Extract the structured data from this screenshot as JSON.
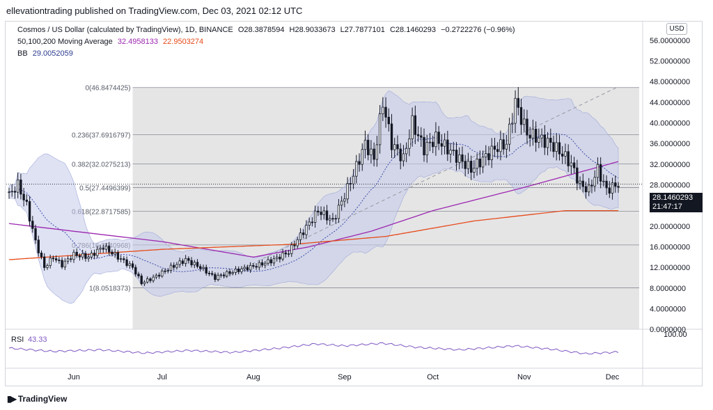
{
  "publisher_line": "ellevationtrading published on TradingView.com, Dec 03, 2021 02:12 UTC",
  "header": {
    "symbol": "Cosmos / US Dollar (calculated by TradingView), 1D, BINANCE",
    "open": "O28.3878594",
    "high": "H28.9033673",
    "low": "L27.7877101",
    "close": "C28.1460293",
    "change": "−0.2722276 (−0.96%)",
    "ma_label": "50,100,200 Moving Average",
    "ma_value_1": "32.4958133",
    "ma_value_2": "22.9503274",
    "bb_label": "BB",
    "bb_value": "29.0052059"
  },
  "currency_button": "USD",
  "last_price": "28.1460293",
  "countdown": "21:47:17",
  "rsi": {
    "label": "RSI",
    "value": "43.33",
    "level_label": "100.00"
  },
  "logo_text": "TradingView",
  "colors": {
    "up": "#ffffff",
    "down": "#131722",
    "ma_purple": "#9c27b0",
    "ma_red": "#e64a19",
    "bb_fill": "#c5cae9",
    "fib_fill": "#dcdcde",
    "rsi_line": "#7e57c2"
  },
  "chart_data": {
    "type": "candlestick",
    "x_axis": {
      "ticks": [
        "Jun",
        "Jul",
        "Aug",
        "Sep",
        "Oct",
        "Nov",
        "Dec"
      ],
      "range": [
        "2021-05-10",
        "2021-12-03"
      ]
    },
    "y_axis": {
      "ticks": [
        "0.0000000",
        "4.0000000",
        "8.0000000",
        "12.0000000",
        "16.0000000",
        "20.0000000",
        "24.0000000",
        "28.0000000",
        "32.0000000",
        "36.0000000",
        "40.0000000",
        "44.0000000",
        "48.0000000",
        "52.0000000",
        "56.0000000"
      ],
      "tick_values": [
        0,
        4,
        8,
        12,
        16,
        20,
        24,
        28,
        32,
        36,
        40,
        44,
        48,
        52,
        56
      ],
      "ylim": [
        -2,
        58
      ]
    },
    "fibonacci": {
      "start_date": "2021-06-21",
      "end_date": "2021-12-03",
      "levels": [
        {
          "label": "0(46.8474425)",
          "value": 46.8474425
        },
        {
          "label": "0.236(37.6916797)",
          "value": 37.6916797
        },
        {
          "label": "0.382(32.0275213)",
          "value": 32.0275213
        },
        {
          "label": "0.5(27.4496399)",
          "value": 27.4496399
        },
        {
          "label": "0.618(22.8717585)",
          "value": 22.8717585
        },
        {
          "label": "0.786(16.3540968)",
          "value": 16.3540968
        },
        {
          "label": "1(8.0518373)",
          "value": 8.0518373
        }
      ]
    },
    "trendline": {
      "from": [
        "2021-07-20",
        9.5
      ],
      "to": [
        "2021-12-03",
        47
      ]
    },
    "close_anchors": [
      [
        "2021-05-10",
        26
      ],
      [
        "2021-05-13",
        28
      ],
      [
        "2021-05-16",
        24
      ],
      [
        "2021-05-19",
        17
      ],
      [
        "2021-05-22",
        12
      ],
      [
        "2021-05-25",
        14
      ],
      [
        "2021-05-28",
        12.5
      ],
      [
        "2021-06-01",
        14.5
      ],
      [
        "2021-06-06",
        14
      ],
      [
        "2021-06-11",
        16
      ],
      [
        "2021-06-16",
        14
      ],
      [
        "2021-06-21",
        12
      ],
      [
        "2021-06-24",
        9
      ],
      [
        "2021-06-28",
        10
      ],
      [
        "2021-07-04",
        12
      ],
      [
        "2021-07-09",
        13.5
      ],
      [
        "2021-07-14",
        12
      ],
      [
        "2021-07-19",
        10
      ],
      [
        "2021-07-21",
        10.5
      ],
      [
        "2021-07-27",
        11.5
      ],
      [
        "2021-08-03",
        12.5
      ],
      [
        "2021-08-08",
        13.5
      ],
      [
        "2021-08-13",
        15
      ],
      [
        "2021-08-18",
        19
      ],
      [
        "2021-08-23",
        23
      ],
      [
        "2021-08-28",
        21
      ],
      [
        "2021-09-01",
        26
      ],
      [
        "2021-09-04",
        30
      ],
      [
        "2021-09-08",
        36
      ],
      [
        "2021-09-11",
        33
      ],
      [
        "2021-09-14",
        44
      ],
      [
        "2021-09-17",
        36
      ],
      [
        "2021-09-21",
        33
      ],
      [
        "2021-09-24",
        40
      ],
      [
        "2021-09-28",
        35
      ],
      [
        "2021-10-02",
        37
      ],
      [
        "2021-10-06",
        35
      ],
      [
        "2021-10-10",
        33
      ],
      [
        "2021-10-14",
        31
      ],
      [
        "2021-10-18",
        33
      ],
      [
        "2021-10-22",
        35
      ],
      [
        "2021-10-26",
        36
      ],
      [
        "2021-10-29",
        44
      ],
      [
        "2021-11-02",
        38
      ],
      [
        "2021-11-06",
        37
      ],
      [
        "2021-11-10",
        36
      ],
      [
        "2021-11-14",
        34
      ],
      [
        "2021-11-17",
        32
      ],
      [
        "2021-11-20",
        28
      ],
      [
        "2021-11-23",
        27
      ],
      [
        "2021-11-26",
        31
      ],
      [
        "2021-11-29",
        27
      ],
      [
        "2021-12-03",
        28.15
      ]
    ],
    "ma_100_anchors": [
      [
        "2021-05-10",
        20.5
      ],
      [
        "2021-06-01",
        19
      ],
      [
        "2021-07-01",
        17
      ],
      [
        "2021-08-01",
        14
      ],
      [
        "2021-08-20",
        16
      ],
      [
        "2021-09-10",
        19
      ],
      [
        "2021-10-01",
        23
      ],
      [
        "2021-11-01",
        27.5
      ],
      [
        "2021-12-03",
        32.5
      ]
    ],
    "ma_200_anchors": [
      [
        "2021-05-10",
        13.5
      ],
      [
        "2021-07-01",
        15.5
      ],
      [
        "2021-08-15",
        16.5
      ],
      [
        "2021-09-15",
        18
      ],
      [
        "2021-10-15",
        21
      ],
      [
        "2021-11-15",
        23
      ],
      [
        "2021-12-03",
        23
      ]
    ],
    "rsi_anchors": [
      [
        "2021-05-10",
        55
      ],
      [
        "2021-05-25",
        45
      ],
      [
        "2021-06-10",
        50
      ],
      [
        "2021-06-25",
        40
      ],
      [
        "2021-07-10",
        48
      ],
      [
        "2021-07-25",
        42
      ],
      [
        "2021-08-10",
        55
      ],
      [
        "2021-08-22",
        68
      ],
      [
        "2021-09-01",
        62
      ],
      [
        "2021-09-14",
        70
      ],
      [
        "2021-09-25",
        58
      ],
      [
        "2021-10-10",
        50
      ],
      [
        "2021-10-29",
        62
      ],
      [
        "2021-11-10",
        52
      ],
      [
        "2021-11-22",
        38
      ],
      [
        "2021-12-03",
        43.33
      ]
    ]
  }
}
